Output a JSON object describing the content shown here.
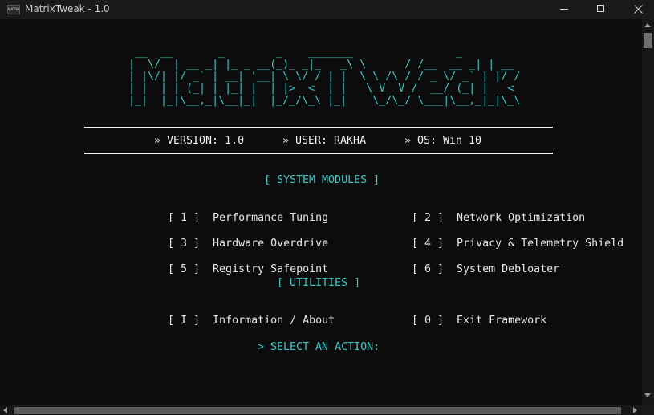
{
  "window": {
    "title": "MatrixTweak - 1.0",
    "icon_label": "MATRIX",
    "icon_name": "console-app-icon",
    "controls": {
      "minimize": "minimize-icon",
      "maximize": "maximize-icon",
      "close": "close-icon"
    }
  },
  "banner": {
    "ascii_logo": " __  __       _        _    _______                _    \n|  \\/  | __ _| |_ _ __(_)_ _|_   _\\ \\      / /__  __ _| | __\n| |\\/| |/ _` | __| '__| \\ \\/ / | |  \\ \\ /\\ / / _ \\/ _` | |/ /\n| |  | | (_| | |_| |  | |>  <  | |   \\ V  V /  __/ (_| |   < \n|_|  |_|\\__,_|\\__|_|  |_/_/\\_\\ |_|    \\_/\\_/ \\___|\\__,_|_|\\_\\",
    "ascii_logo_text": "MatrixTweak",
    "version": "» VERSION: 1.0",
    "user": "» USER: RAKHA",
    "os": "» OS: Win 10"
  },
  "modules": {
    "title": "[ SYSTEM MODULES ]",
    "items": [
      {
        "key": "[ 1 ]",
        "label": "Performance Tuning"
      },
      {
        "key": "[ 2 ]",
        "label": "Network Optimization"
      },
      {
        "key": "[ 3 ]",
        "label": "Hardware Overdrive"
      },
      {
        "key": "[ 4 ]",
        "label": "Privacy & Telemetry Shield"
      },
      {
        "key": "[ 5 ]",
        "label": "Registry Safepoint"
      },
      {
        "key": "[ 6 ]",
        "label": "System Debloater"
      }
    ]
  },
  "utilities": {
    "title": "[ UTILITIES ]",
    "items": [
      {
        "key": "[ I ]",
        "label": "Information / About"
      },
      {
        "key": "[ 0 ]",
        "label": "Exit Framework"
      }
    ]
  },
  "prompt": "> SELECT AN ACTION:",
  "colors": {
    "accent": "#3bc7c7",
    "text": "#e8e8e8",
    "background": "#0c0c0c",
    "titlebar": "#1a1a1a"
  }
}
